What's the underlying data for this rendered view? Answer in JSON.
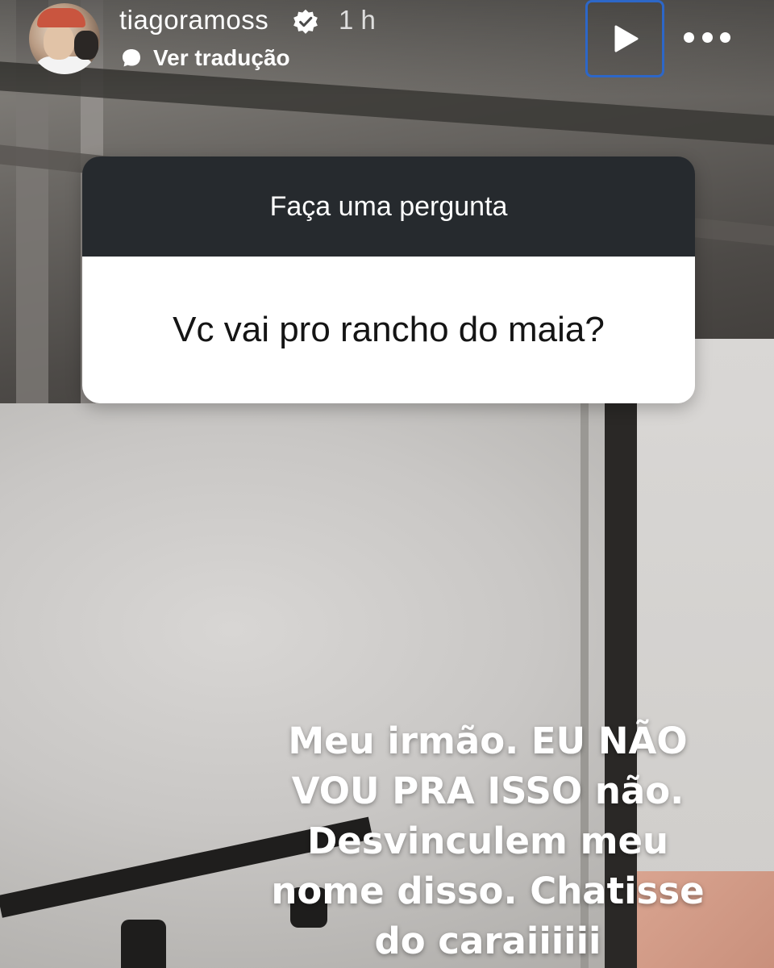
{
  "story": {
    "username": "tiagoramoss",
    "timestamp": "1 h",
    "translate_label": "Ver tradução",
    "verified": true,
    "accent_color": "#2d67c8"
  },
  "controls": {
    "play_icon": "play-icon",
    "more_icon": "more-options-icon"
  },
  "question_sticker": {
    "header": "Faça uma pergunta",
    "question": "Vc vai pro rancho do maia?",
    "header_color": "#262a2e"
  },
  "caption": {
    "lines": [
      "Meu irmão. EU NÃO",
      "VOU PRA ISSO não.",
      "Desvinculem meu",
      "nome disso. Chatisse",
      "do caraiiiiii"
    ]
  }
}
